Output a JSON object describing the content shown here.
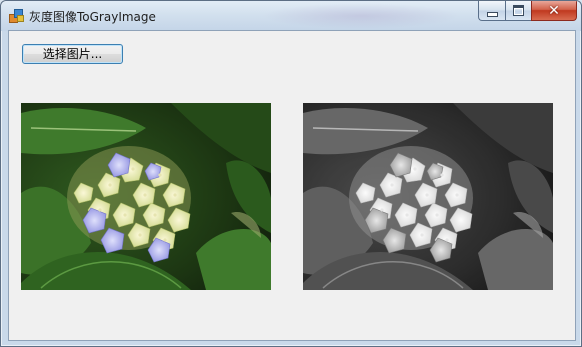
{
  "window": {
    "title": "灰度图像ToGrayImage",
    "icon": "app-icon"
  },
  "titlebar_buttons": {
    "minimize_icon": "minimize-icon",
    "maximize_icon": "maximize-icon",
    "close_icon": "close-icon",
    "close_glyph": "✕"
  },
  "toolbar": {
    "select_image_label": "选择图片..."
  },
  "images": {
    "original": "hydrangea-photo-color",
    "grayscale": "hydrangea-photo-grayscale"
  },
  "colors": {
    "close_red": "#c0381f",
    "client_bg": "#f0f0f0",
    "button_border": "#3c7fb1"
  }
}
